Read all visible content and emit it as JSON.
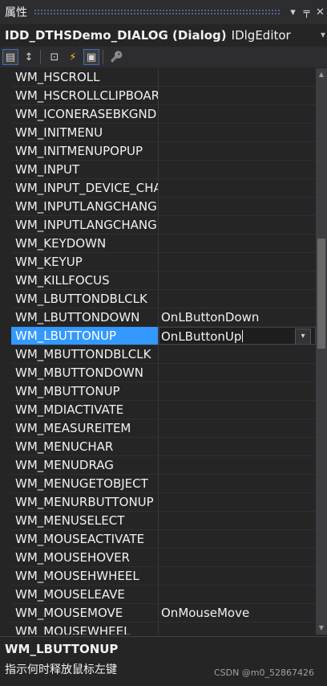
{
  "titlebar": {
    "title": "属性",
    "dropdown_glyph": "▾",
    "pin_glyph": "╤",
    "close_glyph": "✕"
  },
  "object": {
    "name": "IDD_DTHSDemo_DIALOG (Dialog)",
    "type": "IDlgEditor",
    "dropdown_glyph": "▾"
  },
  "toolbar": {
    "buttons": [
      {
        "icon": "categorized-icon",
        "glyph": "▤"
      },
      {
        "icon": "alphabetical-icon",
        "glyph": "↕"
      },
      {
        "icon": "properties-icon",
        "glyph": "⊡"
      },
      {
        "icon": "events-icon",
        "glyph": "⚡"
      },
      {
        "icon": "messages-icon",
        "glyph": "▣"
      },
      {
        "icon": "overrides-icon",
        "glyph": "🔑"
      }
    ]
  },
  "grid": {
    "rows": [
      {
        "name": "WM_HSCROLL",
        "value": ""
      },
      {
        "name": "WM_HSCROLLCLIPBOARD",
        "value": ""
      },
      {
        "name": "WM_ICONERASEBKGND",
        "value": ""
      },
      {
        "name": "WM_INITMENU",
        "value": ""
      },
      {
        "name": "WM_INITMENUPOPUP",
        "value": ""
      },
      {
        "name": "WM_INPUT",
        "value": ""
      },
      {
        "name": "WM_INPUT_DEVICE_CHANGE",
        "value": ""
      },
      {
        "name": "WM_INPUTLANGCHANGE",
        "value": ""
      },
      {
        "name": "WM_INPUTLANGCHANGEREQUEST",
        "value": ""
      },
      {
        "name": "WM_KEYDOWN",
        "value": ""
      },
      {
        "name": "WM_KEYUP",
        "value": ""
      },
      {
        "name": "WM_KILLFOCUS",
        "value": ""
      },
      {
        "name": "WM_LBUTTONDBLCLK",
        "value": ""
      },
      {
        "name": "WM_LBUTTONDOWN",
        "value": "OnLButtonDown"
      },
      {
        "name": "WM_LBUTTONUP",
        "value": "OnLButtonUp"
      },
      {
        "name": "WM_MBUTTONDBLCLK",
        "value": ""
      },
      {
        "name": "WM_MBUTTONDOWN",
        "value": ""
      },
      {
        "name": "WM_MBUTTONUP",
        "value": ""
      },
      {
        "name": "WM_MDIACTIVATE",
        "value": ""
      },
      {
        "name": "WM_MEASUREITEM",
        "value": ""
      },
      {
        "name": "WM_MENUCHAR",
        "value": ""
      },
      {
        "name": "WM_MENUDRAG",
        "value": ""
      },
      {
        "name": "WM_MENUGETOBJECT",
        "value": ""
      },
      {
        "name": "WM_MENURBUTTONUP",
        "value": ""
      },
      {
        "name": "WM_MENUSELECT",
        "value": ""
      },
      {
        "name": "WM_MOUSEACTIVATE",
        "value": ""
      },
      {
        "name": "WM_MOUSEHOVER",
        "value": ""
      },
      {
        "name": "WM_MOUSEHWHEEL",
        "value": ""
      },
      {
        "name": "WM_MOUSELEAVE",
        "value": ""
      },
      {
        "name": "WM_MOUSEMOVE",
        "value": "OnMouseMove"
      },
      {
        "name": "WM_MOUSEWHEEL",
        "value": ""
      }
    ],
    "selected_index": 14,
    "dropdown_glyph": "▾"
  },
  "scrollbar": {
    "up_glyph": "▲",
    "down_glyph": "▼"
  },
  "description": {
    "title": "WM_LBUTTONUP",
    "text": "指示何时释放鼠标左键",
    "watermark": "CSDN @m0_52867426"
  },
  "colors": {
    "selection": "#3399ff",
    "background": "#252526",
    "toolbar": "#2d2d30"
  }
}
